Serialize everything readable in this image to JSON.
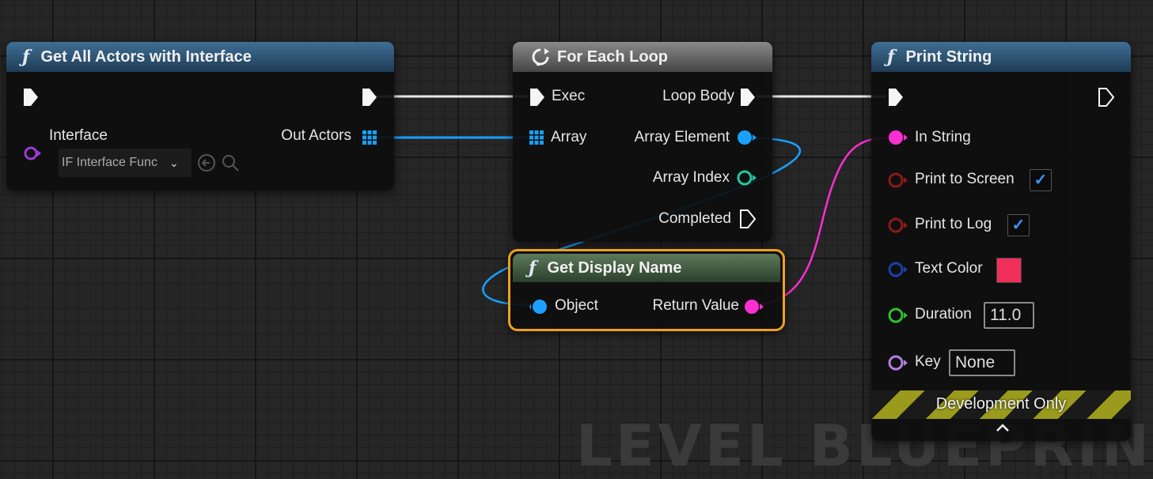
{
  "watermark": "LEVEL BLUEPRIN",
  "nodes": {
    "get_all_actors": {
      "title": "Get All Actors with Interface",
      "icon": "function-icon",
      "interface_label": "Interface",
      "interface_value": "IF Interface Func",
      "out_actors_label": "Out Actors"
    },
    "for_each": {
      "title": "For Each Loop",
      "icon": "loop-macro-icon",
      "exec_label": "Exec",
      "array_label": "Array",
      "loop_body_label": "Loop Body",
      "array_element_label": "Array Element",
      "array_index_label": "Array Index",
      "completed_label": "Completed"
    },
    "get_display_name": {
      "title": "Get Display Name",
      "icon": "function-icon",
      "object_label": "Object",
      "return_label": "Return Value"
    },
    "print_string": {
      "title": "Print String",
      "icon": "function-icon",
      "in_string_label": "In String",
      "print_screen_label": "Print to Screen",
      "print_screen_checked": true,
      "print_log_label": "Print to Log",
      "print_log_checked": true,
      "text_color_label": "Text Color",
      "text_color_value": "#f0305a",
      "duration_label": "Duration",
      "duration_value": "11.0",
      "key_label": "Key",
      "key_value": "None",
      "dev_only_label": "Development Only"
    }
  },
  "colors": {
    "exec": "#ffffff",
    "object": "#1aa0ff",
    "string": "#ff2fd0",
    "bool": "#8b1a1a",
    "linear_color": "#1b3ea8",
    "float": "#2ec02e",
    "integer": "#1fc8a0",
    "name": "#b080e0",
    "interface": "#9a3bd6",
    "selected_outline": "#f0a020"
  }
}
